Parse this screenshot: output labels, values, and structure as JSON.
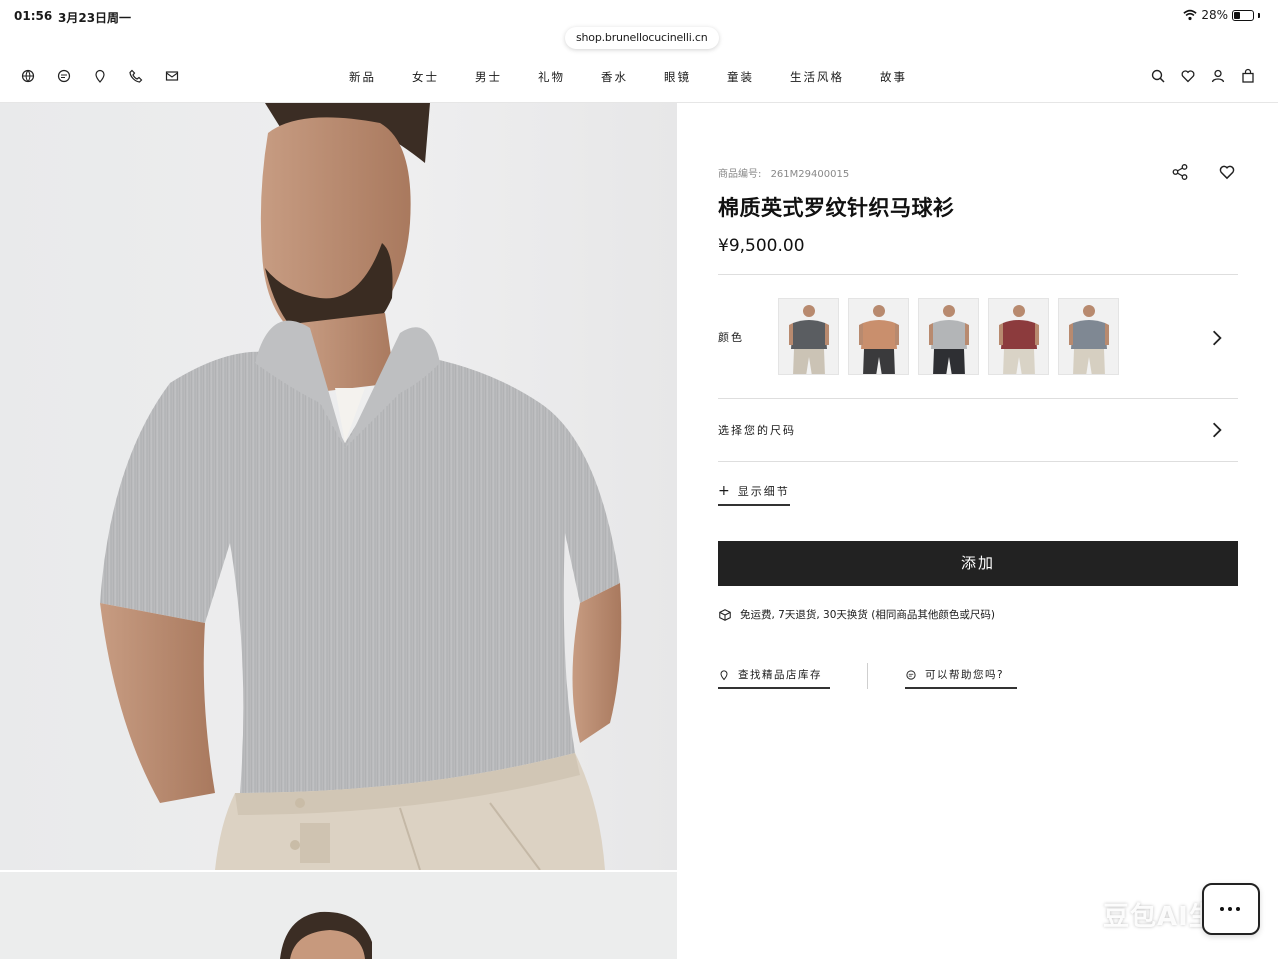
{
  "status_bar": {
    "time": "01:56",
    "date": "3月23日周一",
    "battery": "28%",
    "icons": [
      "wifi-icon",
      "battery-icon"
    ]
  },
  "browser": {
    "url": "shop.brunellocucinelli.cn"
  },
  "nav": {
    "left_icons": [
      "globe-icon",
      "chat-icon",
      "location-icon",
      "phone-icon",
      "mail-icon"
    ],
    "items": [
      "新品",
      "女士",
      "男士",
      "礼物",
      "香水",
      "眼镜",
      "童装",
      "生活风格",
      "故事"
    ],
    "right_icons": [
      "search-icon",
      "heart-icon",
      "user-icon",
      "bag-icon"
    ]
  },
  "product": {
    "sku_label": "商品编号:",
    "sku": "261M29400015",
    "title": "棉质英式罗纹针织马球衫",
    "price": "¥9,500.00",
    "color_label": "颜色",
    "colors": [
      {
        "name": "charcoal",
        "shirt": "#5a5d61",
        "pants": "#cbc3b5"
      },
      {
        "name": "terracotta",
        "shirt": "#c98f6d",
        "pants": "#3a3a3c"
      },
      {
        "name": "light-grey",
        "shirt": "#b3b5b7",
        "pants": "#2e2f33"
      },
      {
        "name": "burgundy",
        "shirt": "#8c3b3d",
        "pants": "#d9d3c6"
      },
      {
        "name": "grey-blue",
        "shirt": "#7f8893",
        "pants": "#d6cfc1"
      }
    ],
    "size_label": "选择您的尺码",
    "details_label": "显示细节",
    "add_button": "添加",
    "shipping_text": "免运费, 7天退货, 30天换货 (相同商品其他颜色或尺码)",
    "store_link": "查找精品店库存",
    "help_link": "可以帮助您吗?"
  },
  "overlay": {
    "watermark": "豆包AI生成"
  },
  "colors": {
    "button": "#222222",
    "divider": "#dedede",
    "background": "#ffffff"
  }
}
